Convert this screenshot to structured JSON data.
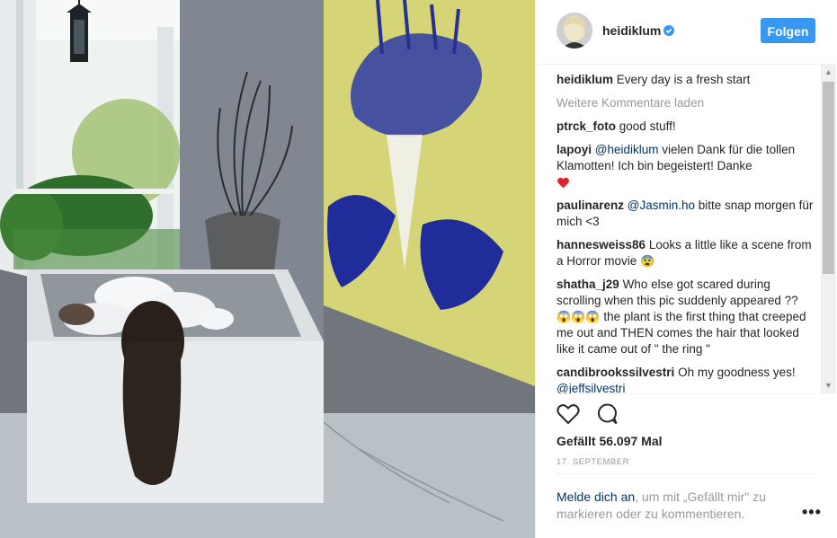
{
  "post": {
    "username": "heidiklum",
    "follow_label": "Folgen",
    "caption_user": "heidiklum",
    "caption_text": "Every day is a fresh start",
    "load_more": "Weitere Kommentare laden",
    "likes": "Gefällt 56.097 Mal",
    "date": "17. SEPTEMBER"
  },
  "comments": [
    {
      "user": "ptrck_foto",
      "text": "good stuff!"
    },
    {
      "user": "lapoyi",
      "mention": "@heidiklum",
      "text": "vielen Dank für die tollen Klamotten! Ich bin begeistert! Danke"
    },
    {
      "user": "paulinarenz",
      "mention": "@Jasmin.ho",
      "text": "bitte snap morgen für mich <3"
    },
    {
      "user": "hannesweiss86",
      "text": "Looks a little like a scene from a Horror movie"
    },
    {
      "user": "shatha_j29",
      "text1": "Who else got scared during scrolling when this pic suddenly appeared ??",
      "text2": "the plant is the first thing that creeped me out and THEN comes the hair that looked like it came out of \" the ring \""
    },
    {
      "user": "candibrookssilvestri",
      "text": "Oh my goodness yes!",
      "mention": "@jeffsilvestri"
    }
  ],
  "login": {
    "link": "Melde dich an",
    "text": ", um mit „Gefällt mir\" zu markieren oder zu kommentieren."
  },
  "more_label": "•••",
  "icons": [
    "verified-icon",
    "heart-icon",
    "comment-icon",
    "more-options-icon"
  ],
  "colors": {
    "accent": "#3897f0",
    "mention": "#003569",
    "muted": "#999999",
    "heart": "#ed4956"
  }
}
